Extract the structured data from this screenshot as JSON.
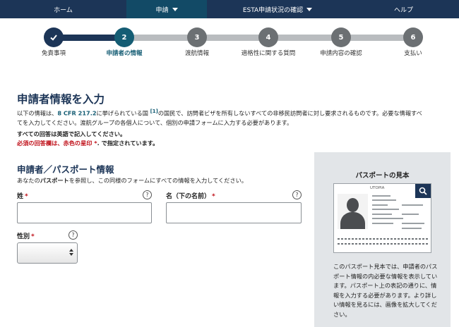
{
  "nav": {
    "items": [
      {
        "label": "ホーム",
        "active": false,
        "dropdown": false
      },
      {
        "label": "申請",
        "active": true,
        "dropdown": true
      },
      {
        "label": "ESTA申請状況の確認",
        "active": false,
        "dropdown": true
      },
      {
        "label": "ヘルプ",
        "active": false,
        "dropdown": false
      }
    ]
  },
  "stepper": {
    "current_step": 2,
    "steps": [
      {
        "number": "",
        "icon": "checkmark-icon",
        "label": "免責事項"
      },
      {
        "number": "2",
        "label": "申請者の情報"
      },
      {
        "number": "3",
        "label": "渡航情報"
      },
      {
        "number": "4",
        "label": "適格性に関する質問"
      },
      {
        "number": "5",
        "label": "申請内容の確認"
      },
      {
        "number": "6",
        "label": "支払い"
      }
    ]
  },
  "main": {
    "title": "申請者情報を入力",
    "intro": {
      "prefix": "以下の情報は、",
      "cfr": "8 CFR 217.2",
      "mid": "に挙げられている国 ",
      "footnote": "[1]",
      "suffix_line1": "の国民で、訪問者ビザを所有しないすべての非移民訪問者に対し要求されるものです。必要な情報すべ",
      "line2": "てを入力してください。渡航グループの各個人について、個別の申請フォームに入力する必要があります。"
    },
    "english_note": "すべての回答は英語で記入してください。",
    "required_note_red": "必須の回答欄は、赤色の星印 *",
    "required_note_rest": ". で指定されています。",
    "section_title": "申請者／パスポート情報",
    "section_desc_prefix": "あなたの",
    "section_desc_bold": "パスポート",
    "section_desc_suffix": "を参照し、この同様のフォームにすべての情報を入力してください。",
    "fields": {
      "surname_label": "姓",
      "given_name_label": "名（下の名前）",
      "gender_label": "性別",
      "required_mark": "*",
      "help_glyph": "?",
      "surname_value": "",
      "given_name_value": "",
      "gender_value": ""
    }
  },
  "passport_sample": {
    "title": "パスポートの見本",
    "country_text": "UTOPIA",
    "description": "このパスポート見本では、申請者のパスポート情報の内必要な情報を表示しています。パスポート上の表記の通りに、情報を入力する必要があります。より詳しい情報を見るには、画像を拡大してください。"
  },
  "colors": {
    "nav_bg": "#1c3557",
    "nav_active": "#124a66",
    "accent": "#155d74",
    "required_red": "#c0121b",
    "panel_bg": "#e2e5e8"
  }
}
